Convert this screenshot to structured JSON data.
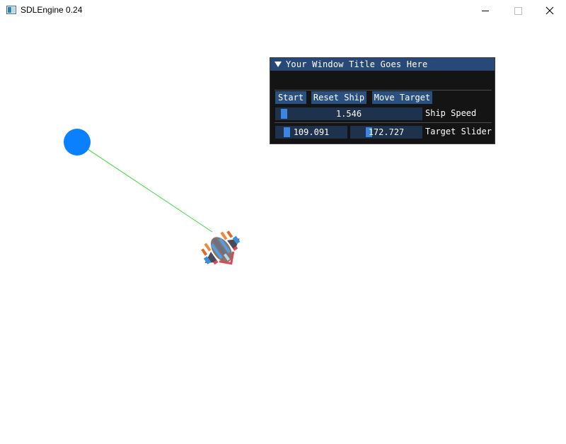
{
  "window": {
    "title": "SDLEngine 0.24",
    "controls": [
      "minimize",
      "maximize",
      "close"
    ]
  },
  "panel": {
    "title": "Your Window Title Goes Here",
    "buttons": {
      "start": "Start",
      "reset_ship": "Reset Ship",
      "move_target": "Move Target"
    },
    "ship_speed": {
      "value": "1.546",
      "label": "Ship Speed",
      "fraction": 0.03
    },
    "target_slider": {
      "x": "109.091",
      "y": "172.727",
      "label": "Target Slider",
      "fraction_x": 0.11,
      "fraction_y": 0.22
    }
  },
  "scene": {
    "target_color": "#0a80ff",
    "line_color": "#33dd33",
    "ship_icon": "spaceship-sprite"
  },
  "colors": {
    "panel_bg": "#141414",
    "title_bg": "#284978",
    "button_bg": "#29507f",
    "slider_bg": "#1e324d",
    "slider_grab": "#3d85e0"
  }
}
